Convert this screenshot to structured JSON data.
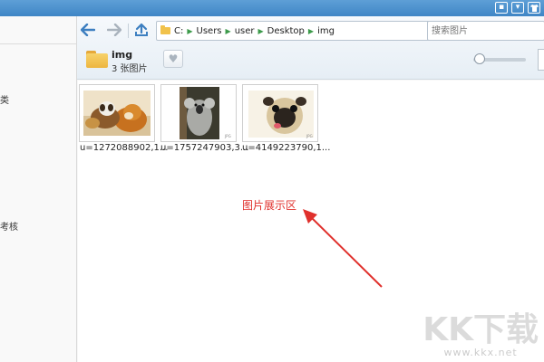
{
  "titlebar": {
    "icons": [
      "chat-icon",
      "dropdown-icon",
      "shirt-icon"
    ]
  },
  "sidebar": {
    "item_a_tail": "类",
    "item_b_tail": "考核"
  },
  "nav": {
    "back_icon": "back-arrow-icon",
    "forward_icon": "forward-arrow-icon",
    "up_icon": "up-folder-icon"
  },
  "address": {
    "segments": [
      "C:",
      "Users",
      "user",
      "Desktop",
      "img"
    ]
  },
  "search": {
    "placeholder": "搜索图片"
  },
  "folder": {
    "name": "img",
    "count": "3 张图片"
  },
  "favorite": {
    "icon": "heart-icon"
  },
  "zoom": {
    "level": 0.05
  },
  "images": [
    {
      "caption": "u=1272088902,1...",
      "subject": "cat and dog"
    },
    {
      "caption": "u=1757247903,3...",
      "subject": "koala"
    },
    {
      "caption": "u=4149223790,1...",
      "subject": "pug"
    }
  ],
  "annotation": {
    "text": "图片展示区"
  },
  "watermark": {
    "text": "KK下载",
    "url": "www.kkx.net"
  },
  "colors": {
    "titlebar": "#4a8fcc",
    "annotation": "#e0302c",
    "path_separator": "#3c9a4a"
  }
}
